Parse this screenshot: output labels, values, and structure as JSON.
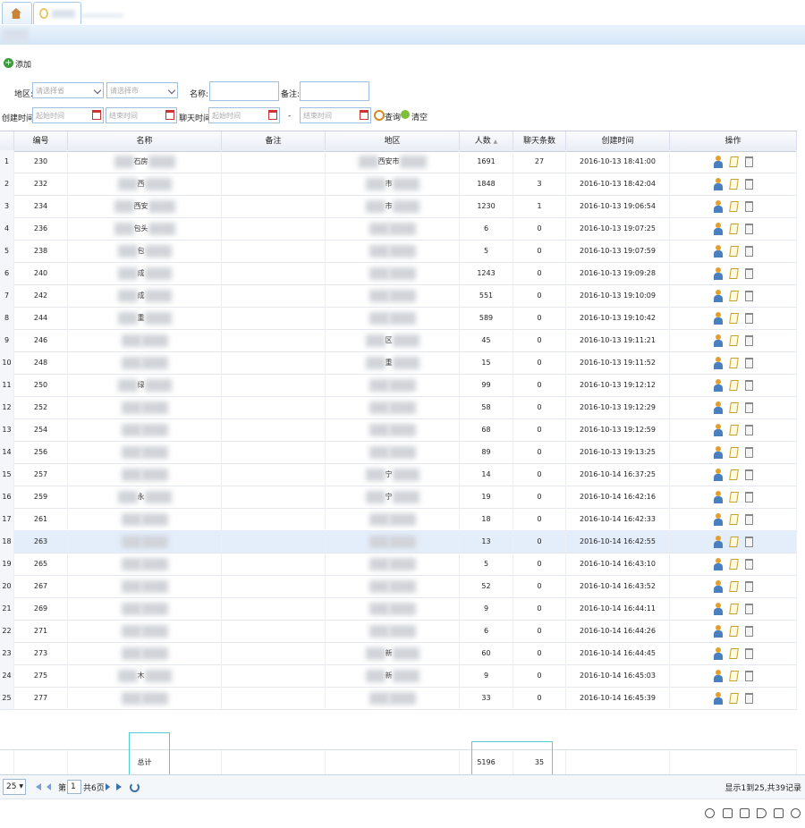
{
  "toolbar": {
    "add_label": "添加",
    "region_label": "地区:",
    "province_placeholder": "请选择省",
    "city_placeholder": "请选择市",
    "name_label": "名称:",
    "remark_label": "备注:",
    "created_label": "创建时间:",
    "start_placeholder": "起始时间",
    "end_placeholder": "结束时间",
    "chat_label": "聊天时间:",
    "dash": "-",
    "query_label": "查询",
    "clear_label": "清空"
  },
  "columns": [
    "编号",
    "名称",
    "备注",
    "地区",
    "人数",
    "聊天条数",
    "创建时间",
    "操作"
  ],
  "rows": [
    {
      "n": "1",
      "id": "230",
      "name": "石房",
      "region": "西安市",
      "count": "1691",
      "chats": "27",
      "time": "2016-10-13 18:41:00"
    },
    {
      "n": "2",
      "id": "232",
      "name": "西",
      "region": "市",
      "count": "1848",
      "chats": "3",
      "time": "2016-10-13 18:42:04"
    },
    {
      "n": "3",
      "id": "234",
      "name": "西安",
      "region": "市",
      "count": "1230",
      "chats": "1",
      "time": "2016-10-13 19:06:54"
    },
    {
      "n": "4",
      "id": "236",
      "name": "包头",
      "region": "",
      "count": "6",
      "chats": "0",
      "time": "2016-10-13 19:07:25"
    },
    {
      "n": "5",
      "id": "238",
      "name": "包",
      "region": "",
      "count": "5",
      "chats": "0",
      "time": "2016-10-13 19:07:59"
    },
    {
      "n": "6",
      "id": "240",
      "name": "成",
      "region": "",
      "count": "1243",
      "chats": "0",
      "time": "2016-10-13 19:09:28"
    },
    {
      "n": "7",
      "id": "242",
      "name": "成",
      "region": "",
      "count": "551",
      "chats": "0",
      "time": "2016-10-13 19:10:09"
    },
    {
      "n": "8",
      "id": "244",
      "name": "重",
      "region": "",
      "count": "589",
      "chats": "0",
      "time": "2016-10-13 19:10:42"
    },
    {
      "n": "9",
      "id": "246",
      "name": "",
      "region": "区",
      "count": "45",
      "chats": "0",
      "time": "2016-10-13 19:11:21"
    },
    {
      "n": "10",
      "id": "248",
      "name": "",
      "region": "重",
      "count": "15",
      "chats": "0",
      "time": "2016-10-13 19:11:52"
    },
    {
      "n": "11",
      "id": "250",
      "name": "绿",
      "region": "",
      "count": "99",
      "chats": "0",
      "time": "2016-10-13 19:12:12"
    },
    {
      "n": "12",
      "id": "252",
      "name": "",
      "region": "",
      "count": "58",
      "chats": "0",
      "time": "2016-10-13 19:12:29"
    },
    {
      "n": "13",
      "id": "254",
      "name": "",
      "region": "",
      "count": "68",
      "chats": "0",
      "time": "2016-10-13 19:12:59"
    },
    {
      "n": "14",
      "id": "256",
      "name": "",
      "region": "",
      "count": "89",
      "chats": "0",
      "time": "2016-10-13 19:13:25"
    },
    {
      "n": "15",
      "id": "257",
      "name": "",
      "region": "宁",
      "count": "14",
      "chats": "0",
      "time": "2016-10-14 16:37:25"
    },
    {
      "n": "16",
      "id": "259",
      "name": "永",
      "region": "宁",
      "count": "19",
      "chats": "0",
      "time": "2016-10-14 16:42:16"
    },
    {
      "n": "17",
      "id": "261",
      "name": "",
      "region": "",
      "count": "18",
      "chats": "0",
      "time": "2016-10-14 16:42:33"
    },
    {
      "n": "18",
      "id": "263",
      "name": "",
      "region": "",
      "count": "13",
      "chats": "0",
      "time": "2016-10-14 16:42:55"
    },
    {
      "n": "19",
      "id": "265",
      "name": "",
      "region": "",
      "count": "5",
      "chats": "0",
      "time": "2016-10-14 16:43:10"
    },
    {
      "n": "20",
      "id": "267",
      "name": "",
      "region": "",
      "count": "52",
      "chats": "0",
      "time": "2016-10-14 16:43:52"
    },
    {
      "n": "21",
      "id": "269",
      "name": "",
      "region": "",
      "count": "9",
      "chats": "0",
      "time": "2016-10-14 16:44:11"
    },
    {
      "n": "22",
      "id": "271",
      "name": "",
      "region": "",
      "count": "6",
      "chats": "0",
      "time": "2016-10-14 16:44:26"
    },
    {
      "n": "23",
      "id": "273",
      "name": "",
      "region": "新",
      "count": "60",
      "chats": "0",
      "time": "2016-10-14 16:44:45"
    },
    {
      "n": "24",
      "id": "275",
      "name": "木",
      "region": "新",
      "count": "9",
      "chats": "0",
      "time": "2016-10-14 16:45:03"
    },
    {
      "n": "25",
      "id": "277",
      "name": "",
      "region": "",
      "count": "33",
      "chats": "0",
      "time": "2016-10-14 16:45:39"
    }
  ],
  "footer": {
    "total_label": "总计",
    "total_count": "5196",
    "total_chats": "35"
  },
  "pager": {
    "page_size": "25",
    "page_prefix": "第",
    "page_value": "1",
    "page_suffix": "共6页",
    "summary": "显示1到25,共39记录"
  },
  "icons": [
    "add-icon",
    "calendar-icon",
    "search-icon",
    "clear-icon",
    "user-icon",
    "edit-icon",
    "trash-icon",
    "refresh-icon",
    "first-page-icon",
    "prev-page-icon",
    "next-page-icon",
    "last-page-icon"
  ]
}
